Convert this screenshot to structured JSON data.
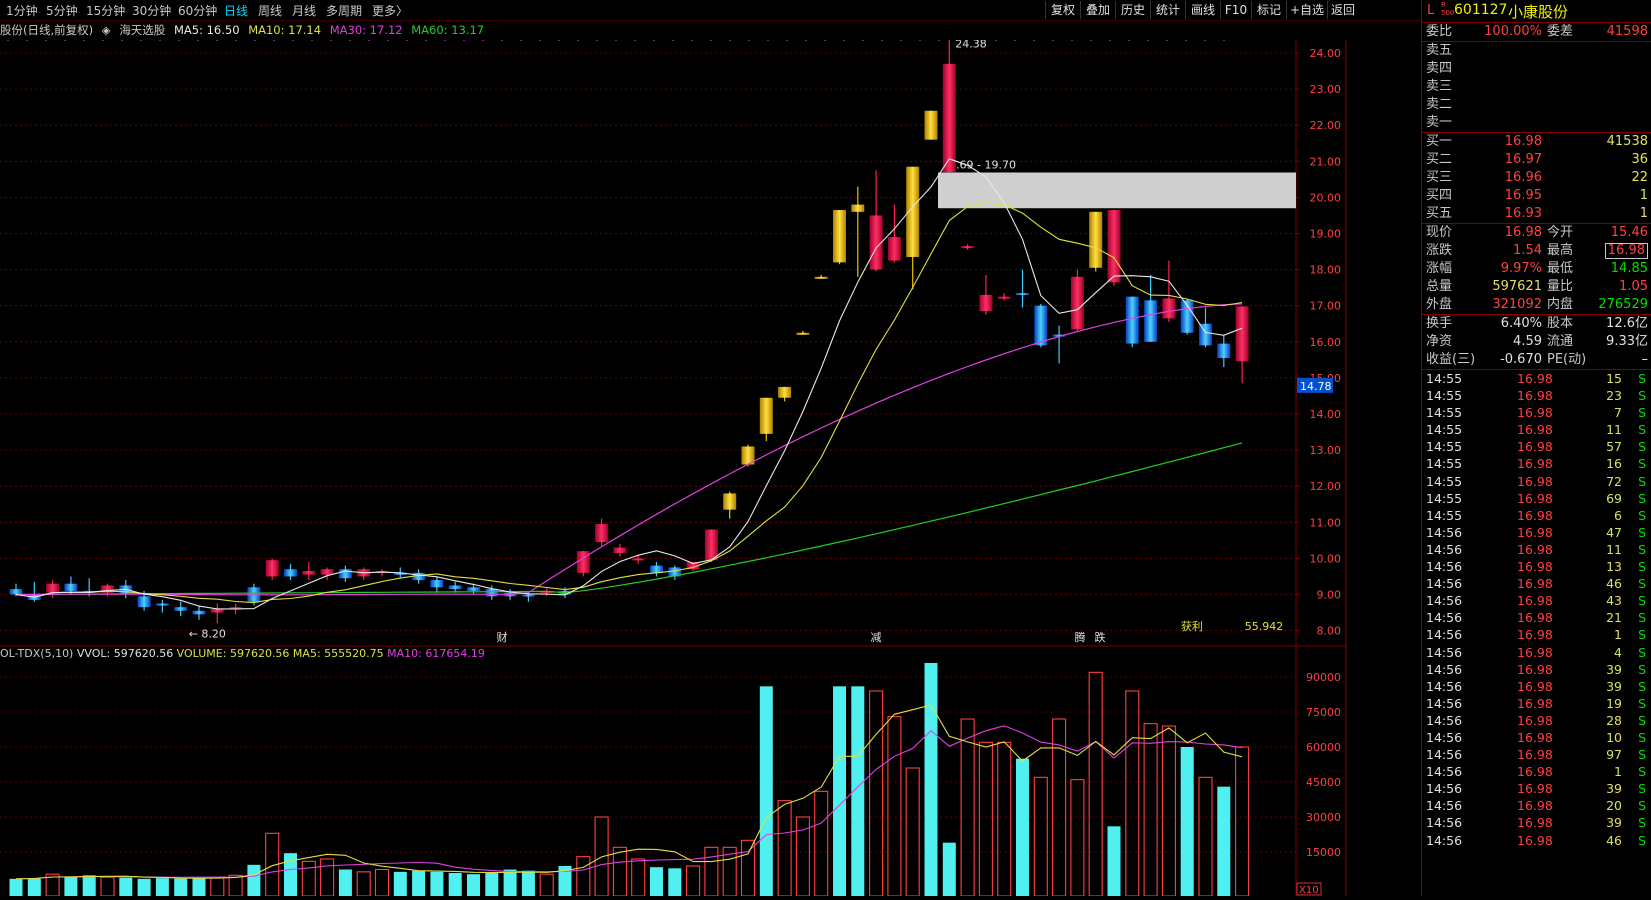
{
  "toolbar": {
    "periods": [
      "1分钟",
      "5分钟",
      "15分钟",
      "30分钟",
      "60分钟",
      "日线",
      "周线",
      "月线",
      "多周期",
      "更多〉"
    ],
    "active_period": "日线",
    "buttons": [
      "复权",
      "叠加",
      "历史",
      "统计",
      "画线",
      "F10",
      "标记",
      "+自选",
      "返回"
    ]
  },
  "legend": {
    "stock": "股份(日线,前复权)",
    "indicator_icon": "settings-diamond-icon",
    "indicator_name": "海天选股",
    "ma5": "MA5: 16.50",
    "ma10": "MA10: 17.14",
    "ma30": "MA30: 17.12",
    "ma60": "MA60: 13.17"
  },
  "colors": {
    "up_red": "#ff2050",
    "down_cyan": "#40c8ff",
    "gold": "#f0c000",
    "ma5": "#e8e8e8",
    "ma10": "#e0e040",
    "ma30": "#e040e0",
    "ma60": "#20d020",
    "grid": "#800000",
    "vol_up": "#ff4040",
    "vol_down": "#50f0f0"
  },
  "price_chart": {
    "y_ticks": [
      "24.00",
      "23.00",
      "22.00",
      "21.00",
      "20.00",
      "19.00",
      "18.00",
      "17.00",
      "16.00",
      "15.00",
      "14.00",
      "13.00",
      "12.00",
      "11.00",
      "10.00",
      "9.00",
      "8.00"
    ],
    "current_price_tag": "14.78",
    "high_label": "24.38",
    "low_label": "8.20",
    "zone_label": "20.69 - 19.70",
    "zone": [
      19.7,
      20.69
    ],
    "markers": [
      "财",
      "减",
      "腾",
      "跌"
    ],
    "profit_label": "获利",
    "profit_value": "55.942"
  },
  "volume_chart": {
    "legend_name": "OL-TDX(5,10)",
    "vvol": "VVOL: 597620.56",
    "volume": "VOLUME: 597620.56",
    "ma5": "MA5: 555520.75",
    "ma10": "MA10: 617654.19",
    "y_ticks": [
      "90000",
      "75000",
      "60000",
      "45000",
      "30000",
      "15000"
    ],
    "unit_label": "X10"
  },
  "quote": {
    "flag": "L",
    "sub_flag": "R 500",
    "code": "601127",
    "name": "小康股份",
    "weibi_label": "委比",
    "weibi": "100.00%",
    "weicha_label": "委差",
    "weicha": "41598",
    "sell": [
      {
        "label": "卖五",
        "price": "",
        "vol": ""
      },
      {
        "label": "卖四",
        "price": "",
        "vol": ""
      },
      {
        "label": "卖三",
        "price": "",
        "vol": ""
      },
      {
        "label": "卖二",
        "price": "",
        "vol": ""
      },
      {
        "label": "卖一",
        "price": "",
        "vol": ""
      }
    ],
    "buy": [
      {
        "label": "买一",
        "price": "16.98",
        "vol": "41538"
      },
      {
        "label": "买二",
        "price": "16.97",
        "vol": "36"
      },
      {
        "label": "买三",
        "price": "16.96",
        "vol": "22"
      },
      {
        "label": "买四",
        "price": "16.95",
        "vol": "1"
      },
      {
        "label": "买五",
        "price": "16.93",
        "vol": "1"
      }
    ],
    "stats": [
      {
        "l1": "现价",
        "v1": "16.98",
        "l2": "今开",
        "v2": "15.46",
        "c1": "red",
        "c2": "red"
      },
      {
        "l1": "涨跌",
        "v1": "1.54",
        "l2": "最高",
        "v2": "16.98",
        "c1": "red",
        "c2": "red"
      },
      {
        "l1": "涨幅",
        "v1": "9.97%",
        "l2": "最低",
        "v2": "14.85",
        "c1": "red",
        "c2": "grn"
      },
      {
        "l1": "总量",
        "v1": "597621",
        "l2": "量比",
        "v2": "1.05",
        "c1": "yel",
        "c2": "red"
      },
      {
        "l1": "外盘",
        "v1": "321092",
        "l2": "内盘",
        "v2": "276529",
        "c1": "red",
        "c2": "grn"
      }
    ],
    "stats2": [
      {
        "l1": "换手",
        "v1": "6.40%",
        "l2": "股本",
        "v2": "12.6亿",
        "c1": "wht",
        "c2": "wht"
      },
      {
        "l1": "净资",
        "v1": "4.59",
        "l2": "流通",
        "v2": "9.33亿",
        "c1": "wht",
        "c2": "wht"
      },
      {
        "l1": "收益(三)",
        "v1": "-0.670",
        "l2": "PE(动)",
        "v2": "–",
        "c1": "wht",
        "c2": "wht"
      }
    ],
    "ticks": [
      {
        "t": "14:55",
        "p": "16.98",
        "q": "15",
        "s": "S"
      },
      {
        "t": "14:55",
        "p": "16.98",
        "q": "23",
        "s": "S"
      },
      {
        "t": "14:55",
        "p": "16.98",
        "q": "7",
        "s": "S"
      },
      {
        "t": "14:55",
        "p": "16.98",
        "q": "11",
        "s": "S"
      },
      {
        "t": "14:55",
        "p": "16.98",
        "q": "57",
        "s": "S"
      },
      {
        "t": "14:55",
        "p": "16.98",
        "q": "16",
        "s": "S"
      },
      {
        "t": "14:55",
        "p": "16.98",
        "q": "72",
        "s": "S"
      },
      {
        "t": "14:55",
        "p": "16.98",
        "q": "69",
        "s": "S"
      },
      {
        "t": "14:55",
        "p": "16.98",
        "q": "6",
        "s": "S"
      },
      {
        "t": "14:56",
        "p": "16.98",
        "q": "47",
        "s": "S"
      },
      {
        "t": "14:56",
        "p": "16.98",
        "q": "11",
        "s": "S"
      },
      {
        "t": "14:56",
        "p": "16.98",
        "q": "13",
        "s": "S"
      },
      {
        "t": "14:56",
        "p": "16.98",
        "q": "46",
        "s": "S"
      },
      {
        "t": "14:56",
        "p": "16.98",
        "q": "43",
        "s": "S"
      },
      {
        "t": "14:56",
        "p": "16.98",
        "q": "21",
        "s": "S"
      },
      {
        "t": "14:56",
        "p": "16.98",
        "q": "1",
        "s": "S"
      },
      {
        "t": "14:56",
        "p": "16.98",
        "q": "4",
        "s": "S"
      },
      {
        "t": "14:56",
        "p": "16.98",
        "q": "39",
        "s": "S"
      },
      {
        "t": "14:56",
        "p": "16.98",
        "q": "39",
        "s": "S"
      },
      {
        "t": "14:56",
        "p": "16.98",
        "q": "19",
        "s": "S"
      },
      {
        "t": "14:56",
        "p": "16.98",
        "q": "28",
        "s": "S"
      },
      {
        "t": "14:56",
        "p": "16.98",
        "q": "10",
        "s": "S"
      },
      {
        "t": "14:56",
        "p": "16.98",
        "q": "97",
        "s": "S"
      },
      {
        "t": "14:56",
        "p": "16.98",
        "q": "1",
        "s": "S"
      },
      {
        "t": "14:56",
        "p": "16.98",
        "q": "39",
        "s": "S"
      },
      {
        "t": "14:56",
        "p": "16.98",
        "q": "20",
        "s": "S"
      },
      {
        "t": "14:56",
        "p": "16.98",
        "q": "39",
        "s": "S"
      },
      {
        "t": "14:56",
        "p": "16.98",
        "q": "46",
        "s": "S"
      }
    ]
  },
  "candles": [
    [
      9.15,
      9.3,
      9.0,
      8.95,
      "d"
    ],
    [
      9.0,
      9.35,
      8.85,
      8.8,
      "d"
    ],
    [
      9.05,
      9.4,
      9.3,
      8.9,
      "u"
    ],
    [
      9.3,
      9.5,
      9.1,
      9.0,
      "d"
    ],
    [
      9.1,
      9.45,
      9.05,
      8.95,
      "d"
    ],
    [
      9.05,
      9.3,
      9.25,
      8.95,
      "u"
    ],
    [
      9.25,
      9.4,
      9.0,
      8.9,
      "d"
    ],
    [
      8.95,
      9.1,
      8.65,
      8.55,
      "d"
    ],
    [
      8.7,
      8.85,
      8.75,
      8.5,
      "d"
    ],
    [
      8.65,
      8.8,
      8.55,
      8.4,
      "d"
    ],
    [
      8.55,
      8.7,
      8.45,
      8.3,
      "d"
    ],
    [
      8.5,
      8.75,
      8.6,
      8.2,
      "u"
    ],
    [
      8.6,
      8.75,
      8.65,
      8.45,
      "u"
    ],
    [
      9.2,
      9.3,
      8.8,
      8.7,
      "d"
    ],
    [
      9.5,
      10.0,
      9.95,
      9.4,
      "u"
    ],
    [
      9.7,
      9.85,
      9.5,
      9.4,
      "d"
    ],
    [
      9.55,
      9.9,
      9.65,
      9.4,
      "u"
    ],
    [
      9.55,
      9.75,
      9.7,
      9.4,
      "u"
    ],
    [
      9.7,
      9.8,
      9.45,
      9.35,
      "d"
    ],
    [
      9.5,
      9.75,
      9.7,
      9.4,
      "u"
    ],
    [
      9.65,
      9.7,
      9.6,
      9.5,
      "u"
    ],
    [
      9.6,
      9.75,
      9.55,
      9.45,
      "d"
    ],
    [
      9.6,
      9.7,
      9.4,
      9.3,
      "d"
    ],
    [
      9.4,
      9.5,
      9.2,
      9.05,
      "d"
    ],
    [
      9.25,
      9.35,
      9.15,
      9.05,
      "d"
    ],
    [
      9.2,
      9.3,
      9.1,
      9.0,
      "d"
    ],
    [
      9.15,
      9.25,
      8.95,
      8.85,
      "d"
    ],
    [
      9.05,
      9.15,
      8.95,
      8.85,
      "d"
    ],
    [
      9.0,
      9.1,
      8.95,
      8.8,
      "d"
    ],
    [
      9.05,
      9.2,
      9.1,
      8.95,
      "u"
    ],
    [
      9.1,
      9.2,
      9.0,
      8.9,
      "d"
    ],
    [
      9.6,
      10.2,
      10.2,
      9.5,
      "u"
    ],
    [
      10.45,
      11.1,
      10.95,
      10.35,
      "u"
    ],
    [
      10.15,
      10.4,
      10.3,
      10.05,
      "u"
    ],
    [
      10.0,
      10.1,
      10.0,
      9.85,
      "u"
    ],
    [
      9.8,
      9.9,
      9.6,
      9.5,
      "d"
    ],
    [
      9.75,
      9.8,
      9.5,
      9.4,
      "d"
    ],
    [
      9.7,
      9.9,
      9.9,
      9.65,
      "u"
    ],
    [
      9.95,
      10.8,
      10.8,
      9.9,
      "u"
    ],
    [
      11.35,
      11.85,
      11.8,
      11.1,
      "g"
    ],
    [
      12.6,
      13.15,
      13.1,
      12.55,
      "g"
    ],
    [
      13.45,
      14.4,
      14.45,
      13.25,
      "g"
    ],
    [
      14.45,
      14.75,
      14.75,
      14.35,
      "g"
    ],
    [
      16.25,
      16.3,
      16.25,
      16.2,
      "g"
    ],
    [
      17.8,
      17.85,
      17.8,
      17.75,
      "g"
    ],
    [
      18.2,
      19.65,
      19.65,
      18.15,
      "g"
    ],
    [
      19.6,
      20.3,
      19.8,
      17.8,
      "g"
    ],
    [
      18.0,
      20.75,
      19.5,
      17.95,
      "u"
    ],
    [
      18.25,
      19.8,
      18.9,
      18.2,
      "u"
    ],
    [
      18.35,
      20.8,
      20.85,
      17.45,
      "g"
    ],
    [
      21.6,
      22.4,
      22.4,
      21.6,
      "g"
    ],
    [
      20.7,
      24.38,
      23.7,
      20.7,
      "u"
    ],
    [
      18.65,
      18.7,
      18.6,
      18.55,
      "u"
    ],
    [
      16.85,
      17.85,
      17.3,
      16.75,
      "u"
    ],
    [
      17.25,
      17.35,
      17.25,
      17.15,
      "u"
    ],
    [
      17.35,
      18.0,
      17.35,
      16.95,
      "d"
    ],
    [
      17.0,
      17.05,
      15.9,
      15.85,
      "d"
    ],
    [
      16.2,
      16.45,
      16.15,
      15.4,
      "d"
    ],
    [
      16.35,
      18.0,
      17.8,
      16.3,
      "u"
    ],
    [
      18.05,
      19.6,
      19.6,
      17.95,
      "g"
    ],
    [
      17.65,
      19.65,
      19.65,
      17.55,
      "u"
    ],
    [
      17.25,
      17.25,
      15.95,
      15.85,
      "d"
    ],
    [
      17.15,
      17.85,
      16.0,
      16.0,
      "d"
    ],
    [
      16.65,
      18.25,
      17.2,
      16.55,
      "u"
    ],
    [
      17.15,
      17.2,
      16.25,
      16.2,
      "d"
    ],
    [
      16.5,
      16.95,
      15.9,
      15.85,
      "d"
    ],
    [
      15.95,
      16.2,
      15.55,
      15.3,
      "d"
    ],
    [
      15.46,
      16.98,
      16.98,
      14.85,
      "u"
    ]
  ],
  "volumes": [
    [
      3500,
      "d"
    ],
    [
      3800,
      "d"
    ],
    [
      5500,
      "u"
    ],
    [
      4500,
      "d"
    ],
    [
      5000,
      "d"
    ],
    [
      4200,
      "u"
    ],
    [
      4000,
      "d"
    ],
    [
      3500,
      "d"
    ],
    [
      3800,
      "d"
    ],
    [
      3600,
      "d"
    ],
    [
      3900,
      "d"
    ],
    [
      4200,
      "u"
    ],
    [
      5000,
      "u"
    ],
    [
      9500,
      "d"
    ],
    [
      23000,
      "u"
    ],
    [
      14500,
      "d"
    ],
    [
      11000,
      "u"
    ],
    [
      12000,
      "u"
    ],
    [
      7500,
      "d"
    ],
    [
      6500,
      "u"
    ],
    [
      7500,
      "u"
    ],
    [
      6500,
      "d"
    ],
    [
      7000,
      "d"
    ],
    [
      6500,
      "d"
    ],
    [
      6000,
      "d"
    ],
    [
      5500,
      "d"
    ],
    [
      6000,
      "d"
    ],
    [
      7500,
      "d"
    ],
    [
      7000,
      "d"
    ],
    [
      5500,
      "u"
    ],
    [
      9000,
      "d"
    ],
    [
      13000,
      "u"
    ],
    [
      30000,
      "u"
    ],
    [
      17000,
      "u"
    ],
    [
      12000,
      "u"
    ],
    [
      8500,
      "d"
    ],
    [
      8000,
      "d"
    ],
    [
      9000,
      "u"
    ],
    [
      17000,
      "u"
    ],
    [
      17000,
      "u"
    ],
    [
      20000,
      "u"
    ],
    [
      86000,
      "d"
    ],
    [
      37000,
      "u"
    ],
    [
      30000,
      "u"
    ],
    [
      41000,
      "u"
    ],
    [
      86000,
      "d"
    ],
    [
      86000,
      "d"
    ],
    [
      84000,
      "u"
    ],
    [
      73000,
      "u"
    ],
    [
      51000,
      "u"
    ],
    [
      96000,
      "d"
    ],
    [
      19000,
      "d"
    ],
    [
      72000,
      "u"
    ],
    [
      62000,
      "u"
    ],
    [
      62000,
      "u"
    ],
    [
      55000,
      "d"
    ],
    [
      47000,
      "u"
    ],
    [
      72000,
      "u"
    ],
    [
      46000,
      "u"
    ],
    [
      92000,
      "u"
    ],
    [
      26000,
      "d"
    ],
    [
      84000,
      "u"
    ],
    [
      70000,
      "u"
    ],
    [
      69000,
      "u"
    ],
    [
      60000,
      "d"
    ],
    [
      47000,
      "u"
    ],
    [
      43000,
      "d"
    ],
    [
      60000,
      "u"
    ]
  ]
}
